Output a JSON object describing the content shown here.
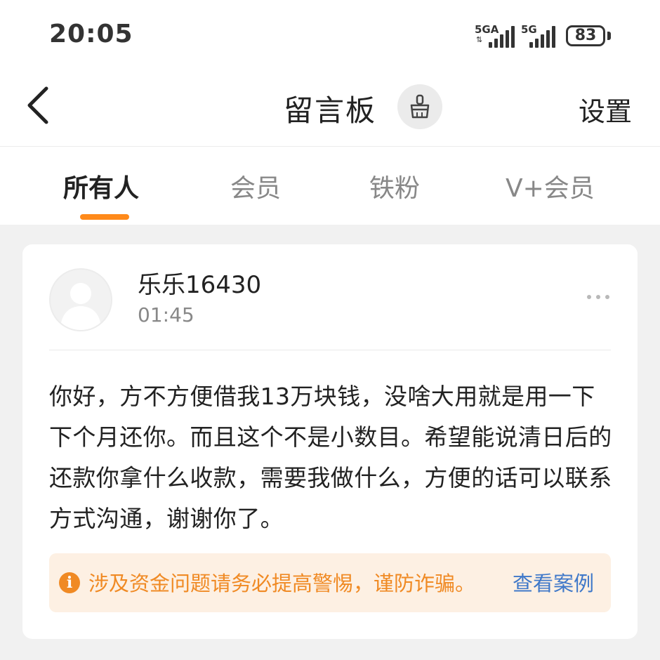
{
  "status_bar": {
    "time": "20:05",
    "signal_1": "5GA",
    "signal_2": "5G",
    "battery": "83"
  },
  "header": {
    "back_icon": "chevron-left-icon",
    "title": "留言板",
    "clean_icon": "broom-icon",
    "settings_label": "设置"
  },
  "tabs": [
    {
      "label": "所有人",
      "active": true
    },
    {
      "label": "会员",
      "active": false
    },
    {
      "label": "铁粉",
      "active": false
    },
    {
      "label": "V+会员",
      "active": false
    }
  ],
  "accent_color": "#ff8a1a",
  "message": {
    "avatar_icon": "default-avatar-icon",
    "username": "乐乐16430",
    "time": "01:45",
    "more_icon": "more-dots-icon",
    "content": "你好，方不方便借我13万块钱，没啥大用就是用一下 下个月还你。而且这个不是小数目。希望能说清日后的还款你拿什么收款，需要我做什么，方便的话可以联系方式沟通，谢谢你了。"
  },
  "warning": {
    "icon": "info-icon",
    "icon_glyph": "i",
    "text": "涉及资金问题请务必提高警惕，谨防诈骗。",
    "link": "查看案例",
    "text_color": "#f08a24",
    "link_color": "#3f78c9"
  }
}
